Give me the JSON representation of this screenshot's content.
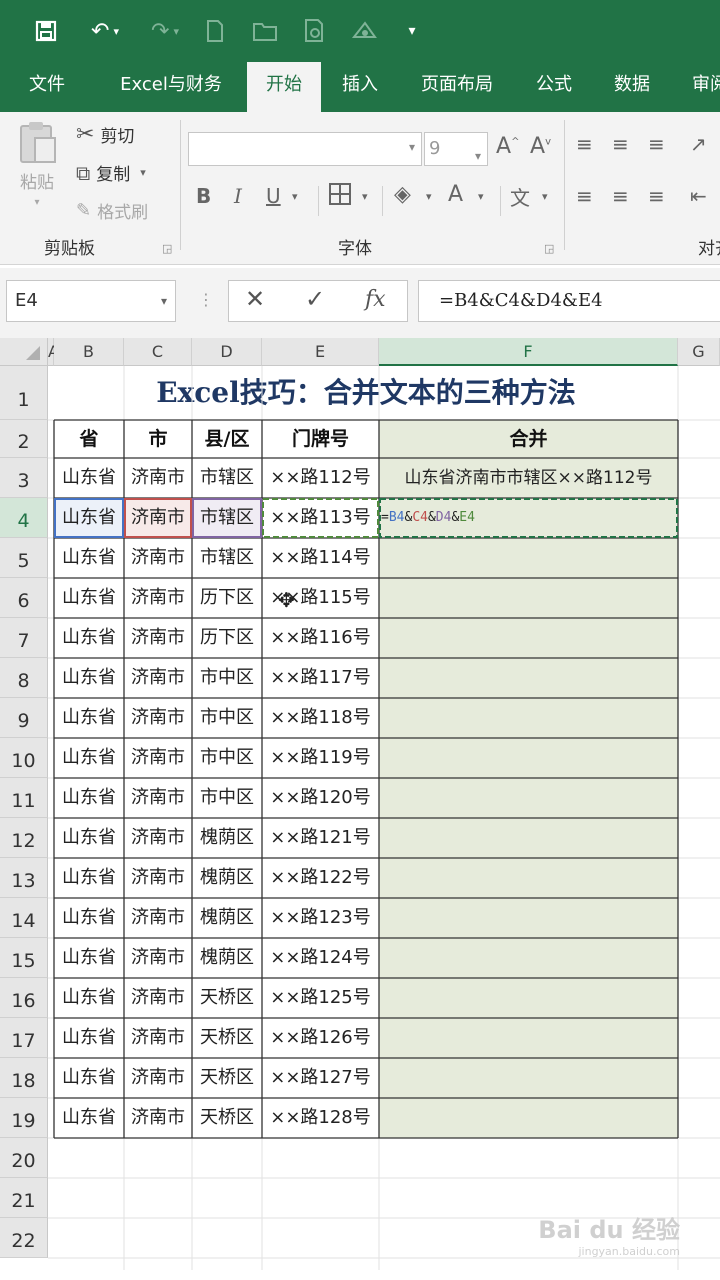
{
  "colors": {
    "accent": "#217346",
    "merge_fill": "#e6ebdb",
    "title_text": "#1f3864",
    "ref_b": "#4472c4",
    "ref_c": "#c0504d",
    "ref_d": "#8064a2",
    "ref_e": "#4f8a3c"
  },
  "quick_access": {
    "save_icon": "save-icon",
    "undo_icon": "undo-icon",
    "redo_icon": "redo-icon",
    "customize": "▾"
  },
  "tabs": [
    {
      "label": "文件"
    },
    {
      "label": "Excel与财务"
    },
    {
      "label": "开始"
    },
    {
      "label": "插入"
    },
    {
      "label": "页面布局"
    },
    {
      "label": "公式"
    },
    {
      "label": "数据"
    },
    {
      "label": "审阅"
    }
  ],
  "ribbon": {
    "clipboard": {
      "paste": "粘贴",
      "cut": "剪切",
      "copy": "复制",
      "format_painter": "格式刷",
      "group": "剪贴板"
    },
    "font": {
      "name": "",
      "size": "9",
      "bold": "B",
      "italic": "I",
      "underline": "U",
      "group": "字体"
    },
    "align": {
      "group": "对齐"
    }
  },
  "formula_bar": {
    "name_box": "E4",
    "cancel": "✕",
    "enter": "✓",
    "fx": "fx",
    "formula": "=B4&C4&D4&E4"
  },
  "columns": [
    "A",
    "B",
    "C",
    "D",
    "E",
    "F",
    "G"
  ],
  "rows": [
    "1",
    "2",
    "3",
    "4",
    "5",
    "6",
    "7",
    "8",
    "9",
    "10",
    "11",
    "12",
    "13",
    "14",
    "15",
    "16",
    "17",
    "18",
    "19",
    "20",
    "21",
    "22"
  ],
  "sheet": {
    "title": "Excel技巧：合并文本的三种方法",
    "headers": [
      "省",
      "市",
      "县/区",
      "门牌号",
      "合并"
    ],
    "data": [
      [
        "山东省",
        "济南市",
        "市辖区",
        "××路112号",
        "山东省济南市市辖区××路112号"
      ],
      [
        "山东省",
        "济南市",
        "市辖区",
        "××路113号",
        ""
      ],
      [
        "山东省",
        "济南市",
        "市辖区",
        "××路114号",
        ""
      ],
      [
        "山东省",
        "济南市",
        "历下区",
        "××路115号",
        ""
      ],
      [
        "山东省",
        "济南市",
        "历下区",
        "××路116号",
        ""
      ],
      [
        "山东省",
        "济南市",
        "市中区",
        "××路117号",
        ""
      ],
      [
        "山东省",
        "济南市",
        "市中区",
        "××路118号",
        ""
      ],
      [
        "山东省",
        "济南市",
        "市中区",
        "××路119号",
        ""
      ],
      [
        "山东省",
        "济南市",
        "市中区",
        "××路120号",
        ""
      ],
      [
        "山东省",
        "济南市",
        "槐荫区",
        "××路121号",
        ""
      ],
      [
        "山东省",
        "济南市",
        "槐荫区",
        "××路122号",
        ""
      ],
      [
        "山东省",
        "济南市",
        "槐荫区",
        "××路123号",
        ""
      ],
      [
        "山东省",
        "济南市",
        "槐荫区",
        "××路124号",
        ""
      ],
      [
        "山东省",
        "济南市",
        "天桥区",
        "××路125号",
        ""
      ],
      [
        "山东省",
        "济南市",
        "天桥区",
        "××路126号",
        ""
      ],
      [
        "山东省",
        "济南市",
        "天桥区",
        "××路127号",
        ""
      ],
      [
        "山东省",
        "济南市",
        "天桥区",
        "××路128号",
        ""
      ]
    ],
    "formula_parts": [
      "=",
      "B4",
      "&",
      "C4",
      "&",
      "D4",
      "&",
      "E4"
    ]
  },
  "watermark": {
    "logo": "Bai du 经验",
    "url": "jingyan.baidu.com"
  }
}
